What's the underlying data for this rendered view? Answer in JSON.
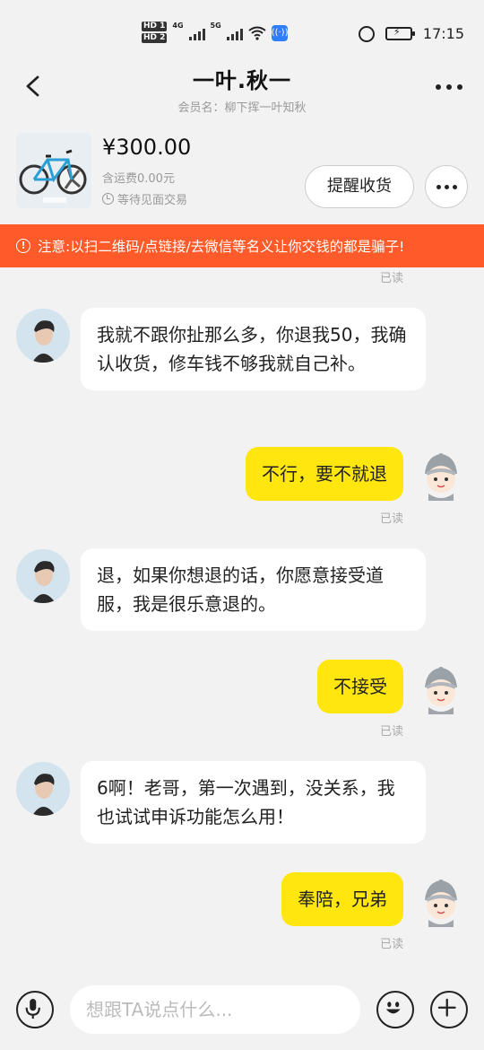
{
  "status_bar": {
    "time": "17:15",
    "network_4g": "4G",
    "network_5g": "5G",
    "hd1": "HD 1",
    "hd2": "HD 2",
    "icons": [
      "hd-icon",
      "signal-icon",
      "wifi-icon",
      "hotspot-icon",
      "alarm-icon",
      "battery-charging-icon"
    ]
  },
  "header": {
    "title": "一叶.秋一",
    "subtitle": "会员名：柳下挥一叶知秋"
  },
  "order": {
    "price": "¥300.00",
    "shipping": "含运费0.00元",
    "status": "等待见面交易",
    "remind_label": "提醒收货"
  },
  "warning": {
    "text": "注意:以扫二维码/点链接/去微信等名义让你交钱的都是骗子!",
    "color": "#ff5a2a"
  },
  "messages": {
    "top_read": "已读",
    "list": [
      {
        "side": "left",
        "text": "我就不跟你扯那么多，你退我50，我确认收货，修车钱不够我就自己补。"
      },
      {
        "side": "right",
        "text": "不行，要不就退",
        "status": "已读"
      },
      {
        "side": "left",
        "text": "退，如果你想退的话，你愿意接受道服，我是很乐意退的。"
      },
      {
        "side": "right",
        "text": "不接受",
        "status": "已读"
      },
      {
        "side": "left",
        "text": "6啊！老哥，第一次遇到，没关系，我也试试申诉功能怎么用！"
      },
      {
        "side": "right",
        "text": "奉陪，兄弟",
        "status": "已读"
      }
    ]
  },
  "input": {
    "placeholder": "想跟TA说点什么..."
  },
  "colors": {
    "self_bubble": "#ffe60f",
    "other_bubble": "#ffffff",
    "background": "#f2f2f2"
  }
}
